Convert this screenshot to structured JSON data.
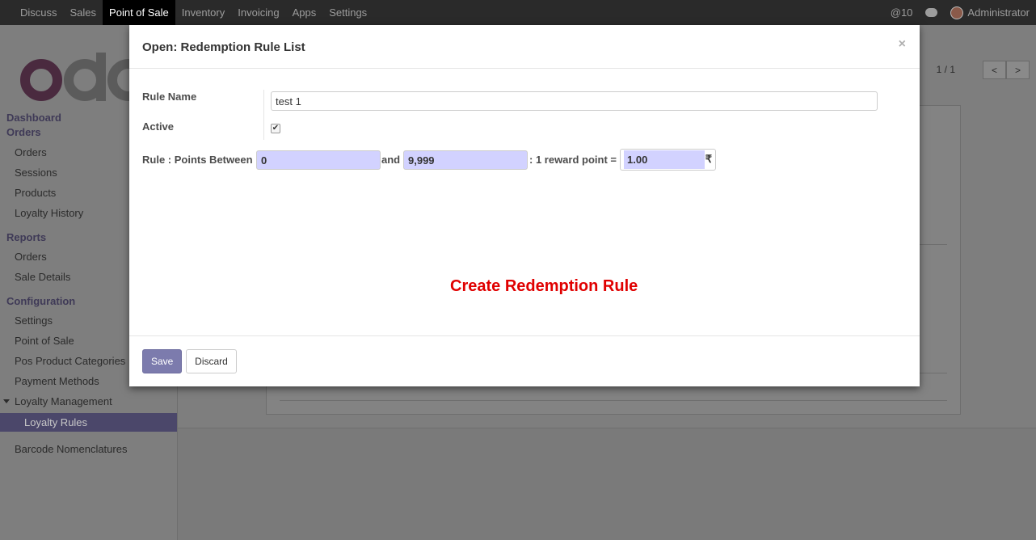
{
  "navbar": {
    "menu": [
      "Discuss",
      "Sales",
      "Point of Sale",
      "Inventory",
      "Invoicing",
      "Apps",
      "Settings"
    ],
    "active": "Point of Sale",
    "mentions": "@10",
    "user": "Administrator"
  },
  "sidebar": {
    "dashboard": "Dashboard",
    "orders_section": "Orders",
    "orders_items": [
      "Orders",
      "Sessions",
      "Products",
      "Loyalty History"
    ],
    "reports_section": "Reports",
    "reports_items": [
      "Orders",
      "Sale Details"
    ],
    "config_section": "Configuration",
    "config_items": [
      "Settings",
      "Point of Sale",
      "Pos Product Categories",
      "Payment Methods",
      "Loyalty Management"
    ],
    "active_item": "Loyalty Rules",
    "barcode": "Barcode Nomenclatures"
  },
  "pager": {
    "text": "1 / 1",
    "prev": "<",
    "next": ">"
  },
  "modal": {
    "title": "Open: Redemption Rule List",
    "close": "×",
    "rule_name_label": "Rule Name",
    "rule_name_value": "test 1",
    "active_label": "Active",
    "active_checked": true,
    "check_mark": "✔",
    "points_between_label": "Rule : Points Between",
    "points_from": "0",
    "and_label": "and",
    "points_to": "9,999",
    "reward_label": ": 1 reward point =",
    "reward_value": "1.00",
    "currency": "₹",
    "banner": "Create Redemption Rule",
    "save_label": "Save",
    "discard_label": "Discard"
  }
}
